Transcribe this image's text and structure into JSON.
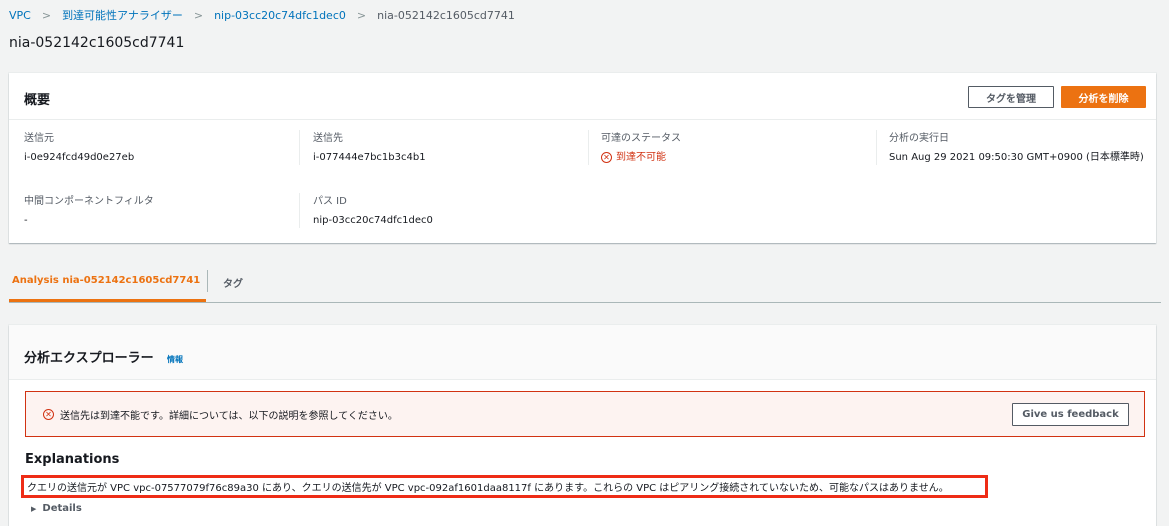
{
  "breadcrumb": {
    "items": [
      {
        "label": "VPC"
      },
      {
        "label": "到達可能性アナライザー"
      },
      {
        "label": "nip-03cc20c74dfc1dec0"
      },
      {
        "label": "nia-052142c1605cd7741"
      }
    ],
    "separator": ">"
  },
  "page_title": "nia-052142c1605cd7741",
  "summary": {
    "title": "概要",
    "manage_tags_label": "タグを管理",
    "delete_label": "分析を削除",
    "fields": {
      "source": {
        "label": "送信元",
        "value": "i-0e924fcd49d0e27eb"
      },
      "destination": {
        "label": "送信先",
        "value": "i-077444e7bc1b3c4b1"
      },
      "status": {
        "label": "可達のステータス",
        "value": "到達不可能"
      },
      "executed": {
        "label": "分析の実行日",
        "value": "Sun Aug 29 2021 09:50:30 GMT+0900 (日本標準時)"
      },
      "filter": {
        "label": "中間コンポーネントフィルタ",
        "value": "-"
      },
      "path_id": {
        "label": "パス ID",
        "value": "nip-03cc20c74dfc1dec0"
      }
    }
  },
  "tabs": [
    {
      "label": "Analysis nia-052142c1605cd7741",
      "active": true
    },
    {
      "label": "タグ",
      "active": false
    }
  ],
  "explorer": {
    "title": "分析エクスプローラー",
    "info_label": "情報",
    "alert_text": "送信先は到達不能です。詳細については、以下の説明を参照してください。",
    "feedback_label": "Give us feedback",
    "explanations_title": "Explanations",
    "explanation_text": "クエリの送信元が VPC vpc-07577079f76c89a30 にあり、クエリの送信先が VPC vpc-092af1601daa8117f にあります。これらの VPC はピアリング接続されていないため、可能なパスはありません。",
    "details_label": "Details"
  },
  "colors": {
    "accent": "#ec7211",
    "link": "#0073bb",
    "error": "#d13212",
    "highlight_border": "#ee2c16"
  },
  "icons": [
    "chevron-right-icon",
    "error-circle-icon",
    "caret-right-icon"
  ]
}
